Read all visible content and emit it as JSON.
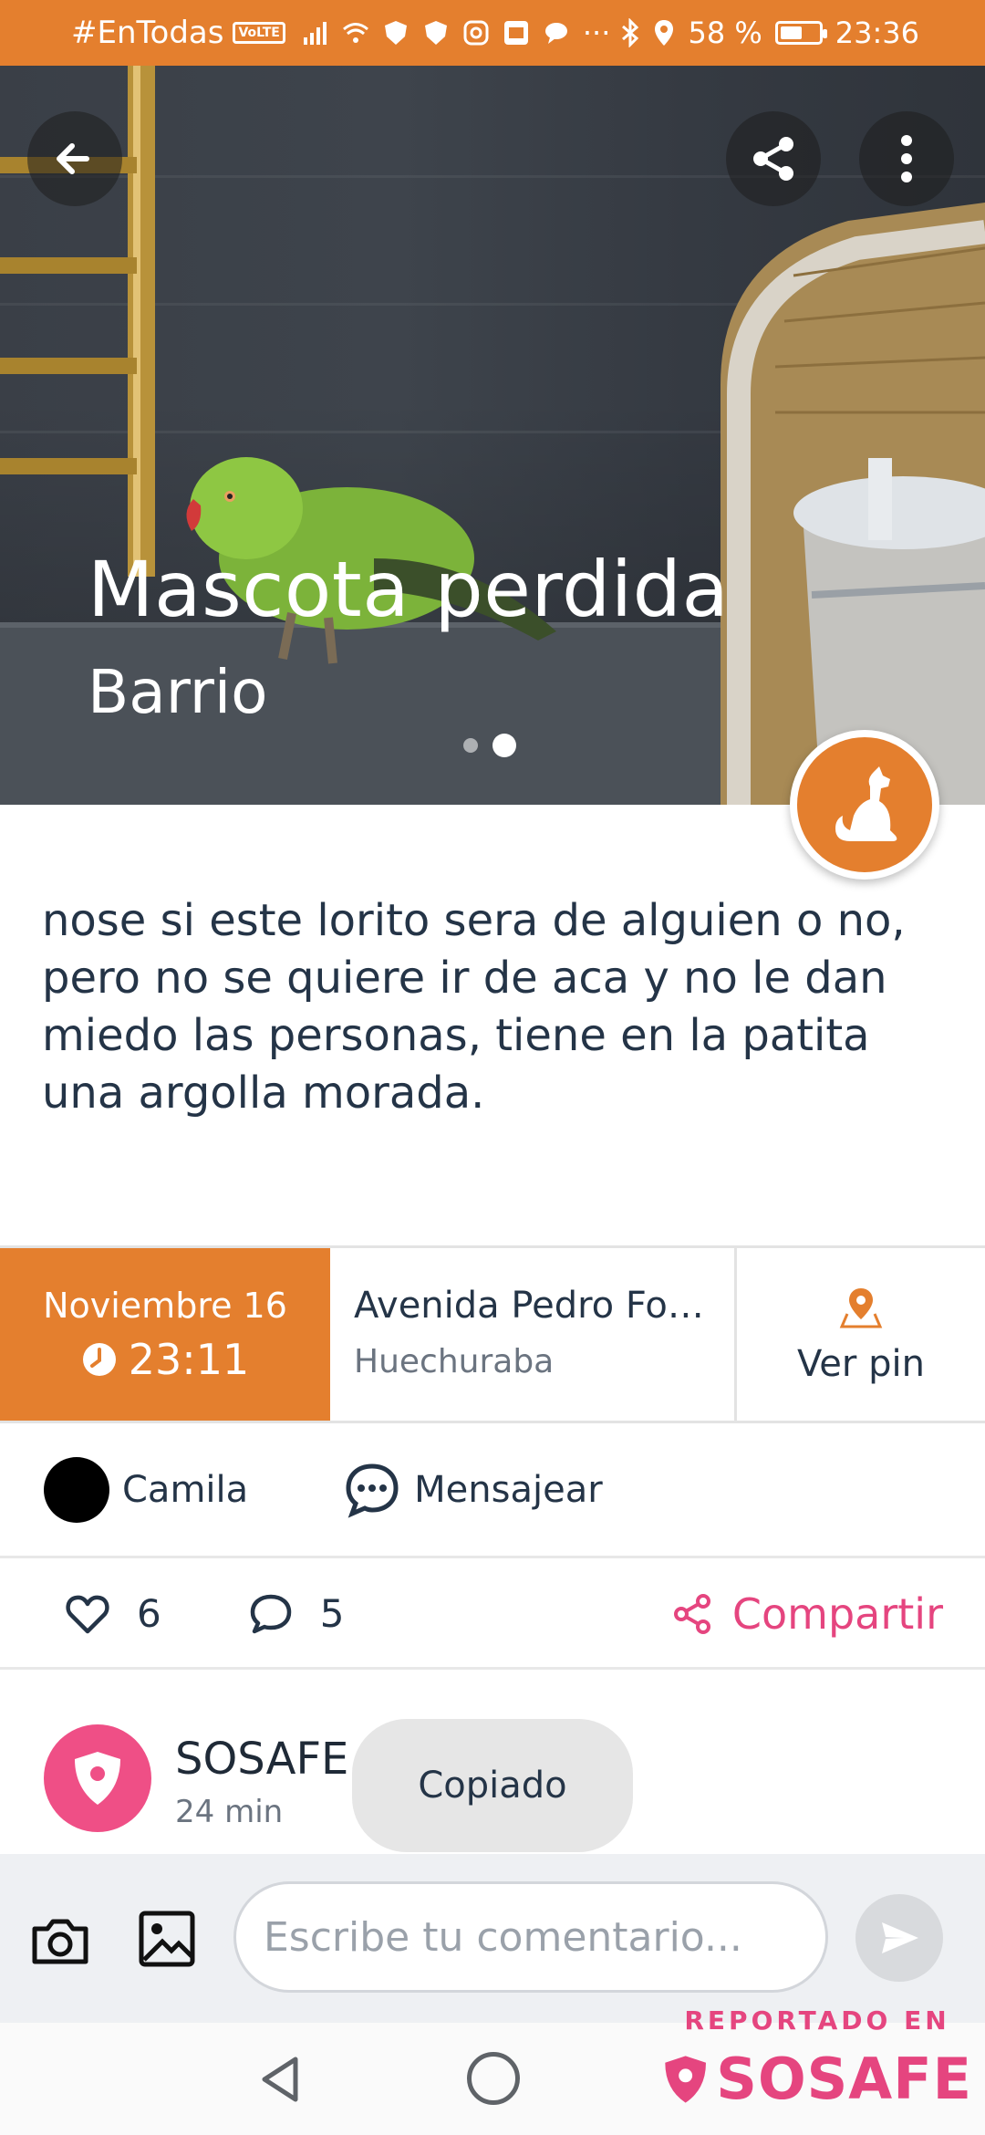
{
  "status_bar": {
    "carrier_tag": "#EnTodas",
    "volte": "VoLTE",
    "overflow": "···",
    "battery": "58 %",
    "battery_level": 0.58,
    "time": "23:36"
  },
  "hero": {
    "title": "Mascota perdida",
    "subtitle": "Barrio",
    "image_count": 2,
    "active_image": 2
  },
  "description": "nose si este lorito sera de alguien o no, pero no se quiere ir de aca y no le dan miedo las personas, tiene en la patita una argolla morada.",
  "info": {
    "date": "Noviembre 16",
    "time": "23:11",
    "street": "Avenida Pedro Fo…",
    "commune": "Huechuraba",
    "pin_label": "Ver pin"
  },
  "author": {
    "name": "Camila",
    "message_label": "Mensajear"
  },
  "actions": {
    "likes": "6",
    "comments": "5",
    "share_label": "Compartir"
  },
  "comment_preview": {
    "author": "SOSAFE",
    "time": "24 min"
  },
  "toast": "Copiado",
  "comment_bar": {
    "placeholder": "Escribe tu comentario..."
  },
  "watermark": {
    "top": "REPORTADO EN",
    "brand": "SOSAFE"
  },
  "colors": {
    "accent_orange": "#E47F2E",
    "accent_pink": "#E5457F",
    "text_dark": "#243447"
  }
}
